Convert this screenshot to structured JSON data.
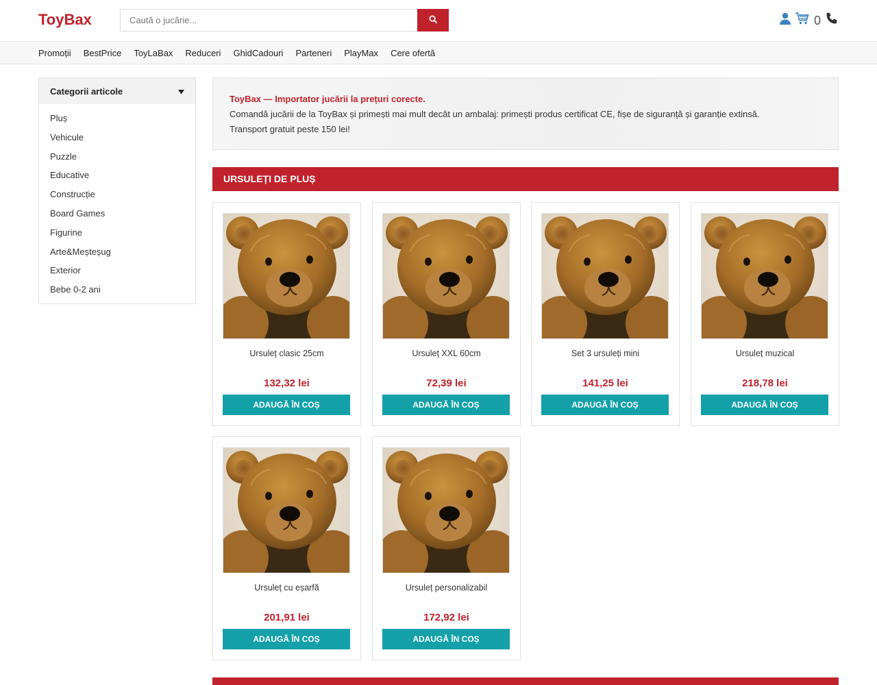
{
  "brand": {
    "logo": "ToyBax"
  },
  "search": {
    "placeholder": "Caută o jucărie...",
    "button_icon": "search-icon"
  },
  "header_icons": {
    "cart_count": "0"
  },
  "nav": {
    "items": [
      "Promoții",
      "BestPrice",
      "ToyLaBax",
      "Reduceri",
      "GhidCadouri",
      "Parteneri",
      "PlayMax",
      "Cere ofertă"
    ]
  },
  "sidebar": {
    "title": "Categorii articole",
    "items": [
      "Pluș",
      "Vehicule",
      "Puzzle",
      "Educative",
      "Construcție",
      "Board Games",
      "Figurine",
      "Arte&Meșteșug",
      "Exterior",
      "Bebe 0-2 ani"
    ]
  },
  "intro": {
    "headline": "ToyBax — Importator jucării la prețuri corecte.",
    "line1": "Comandă jucării de la ToyBax și primești mai mult decât un ambalaj: primești produs certificat CE, fișe de siguranță și garanție extinsă.",
    "line2": "Transport gratuit peste 150 lei!"
  },
  "section": {
    "title": "URSULEȚI DE PLUȘ"
  },
  "products": [
    {
      "name": "Ursuleț clasic 25cm",
      "price": "132,32 lei",
      "button": "ADAUGĂ ÎN COȘ"
    },
    {
      "name": "Ursuleț XXL 60cm",
      "price": "72,39 lei",
      "button": "ADAUGĂ ÎN COȘ"
    },
    {
      "name": "Set 3 ursuleți mini",
      "price": "141,25 lei",
      "button": "ADAUGĂ ÎN COȘ"
    },
    {
      "name": "Ursuleț muzical",
      "price": "218,78 lei",
      "button": "ADAUGĂ ÎN COȘ"
    },
    {
      "name": "Ursuleț cu eșarfă",
      "price": "201,91 lei",
      "button": "ADAUGĂ ÎN COȘ"
    },
    {
      "name": "Ursuleț personalizabil",
      "price": "172,92 lei",
      "button": "ADAUGĂ ÎN COȘ"
    }
  ],
  "colors": {
    "brand_red": "#c0222c",
    "button_teal": "#14a0a8"
  }
}
